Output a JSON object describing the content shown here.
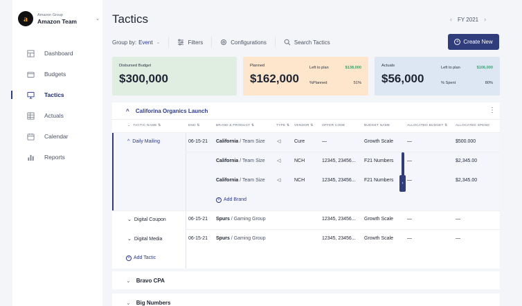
{
  "sidebar": {
    "team_group": "Amazon Group",
    "team_name": "Amazon Team",
    "items": [
      {
        "label": "Dashboard",
        "icon": "dashboard-icon"
      },
      {
        "label": "Budgets",
        "icon": "wallet-icon"
      },
      {
        "label": "Tactics",
        "icon": "monitor-icon",
        "active": true
      },
      {
        "label": "Actuals",
        "icon": "table-icon"
      },
      {
        "label": "Calendar",
        "icon": "calendar-icon"
      },
      {
        "label": "Reports",
        "icon": "bar-chart-icon"
      }
    ]
  },
  "header": {
    "title": "Tactics",
    "fiscal_year": "FY 2021"
  },
  "toolbar": {
    "group_by_label": "Group by:",
    "group_by_value": "Event",
    "filters": "Filters",
    "configurations": "Configurations",
    "search": "Search Tactics",
    "create": "Create New"
  },
  "summary": {
    "disbursed": {
      "label": "Disbursed Budget",
      "value": "$300,000"
    },
    "planned": {
      "label": "Planned",
      "value": "$162,000",
      "left_label": "Left to plan",
      "left_value": "$138,000",
      "pct_label": "%Planned",
      "pct_value": "51%"
    },
    "actuals": {
      "label": "Actuals",
      "value": "$56,000",
      "left_label": "Left to plan",
      "left_value": "$106,000",
      "pct_label": "% Spent",
      "pct_value": "80%"
    }
  },
  "table": {
    "group_name": "Califorina Organics Launch",
    "columns": [
      "Tactic Name",
      "End",
      "Brand & Product",
      "Type",
      "Vendor",
      "Offer Code",
      "Budget Name",
      "Allocated Budget",
      "Allocated Spend"
    ],
    "rows": [
      {
        "tactic": "Daily Mailing",
        "end": "06-15-21",
        "brand": "California",
        "product": "Team Size",
        "vendor": "Cure",
        "offer": "—",
        "budget_name": "Growth Scale",
        "alloc_budget": "—",
        "alloc_spend": "$500.000"
      },
      {
        "tactic": "",
        "end": "",
        "brand": "California",
        "product": "Team Size",
        "vendor": "NCH",
        "offer": "12345, 23456...",
        "budget_name": "F21 Numbers",
        "alloc_budget": "—",
        "alloc_spend": "$2,345.00"
      },
      {
        "tactic": "",
        "end": "",
        "brand": "California",
        "product": "Team Size",
        "vendor": "NCH",
        "offer": "12345, 23456...",
        "budget_name": "F21 Numbers",
        "alloc_budget": "—",
        "alloc_spend": "$2,345.00"
      },
      {
        "tactic": "Digital Coupon",
        "end": "06-15-21",
        "brand": "Spurs",
        "product": "Gaming Group",
        "vendor": "",
        "offer": "12345, 23456...",
        "budget_name": "Growth Scale",
        "alloc_budget": "—",
        "alloc_spend": "—"
      },
      {
        "tactic": "Digital Media",
        "end": "06-15-21",
        "brand": "Spurs",
        "product": "Gaming Group",
        "vendor": "",
        "offer": "12345, 23456...",
        "budget_name": "Growth Scale",
        "alloc_budget": "—",
        "alloc_spend": "—"
      }
    ],
    "add_brand": "Add Brand",
    "add_tactic": "Add Tactic"
  },
  "groups": [
    "Bravo CPA",
    "Big Numbers"
  ],
  "colors": {
    "primary": "#2f3d7d",
    "green": "#29a86a"
  }
}
